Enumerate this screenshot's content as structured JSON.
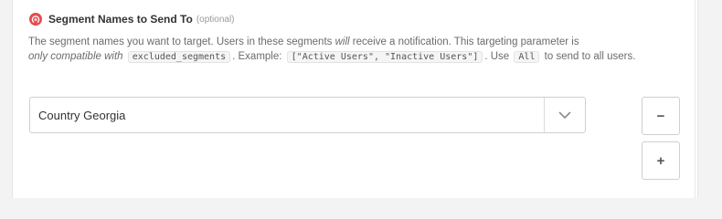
{
  "field": {
    "label": "Segment Names to Send To",
    "optional": "(optional)",
    "icon": "onesignal-app-icon",
    "accent_color": "#e54b4d"
  },
  "description": {
    "part1": "The segment names you want to target. Users in these segments ",
    "will": "will",
    "part2": " receive a notification. This targeting parameter is ",
    "only_compatible": "only compatible with",
    "code_excluded": "excluded_segments",
    "part3": ". Example: ",
    "code_example": "[\"Active Users\", \"Inactive Users\"]",
    "part4": ". Use ",
    "code_all": "All",
    "part5": " to send to all users."
  },
  "select": {
    "value": "Country Georgia",
    "icon": "chevron-down-icon"
  },
  "buttons": {
    "remove_label": "−",
    "add_label": "+"
  }
}
